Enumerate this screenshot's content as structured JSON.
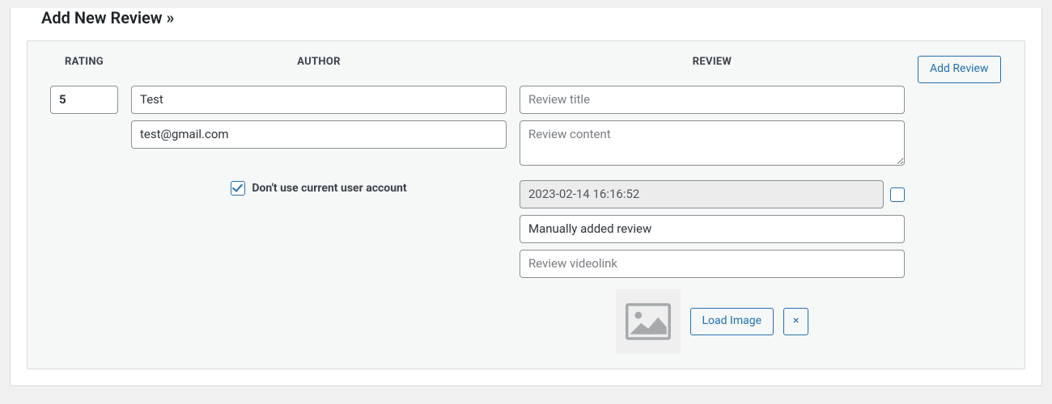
{
  "panel": {
    "title": "Add New Review »"
  },
  "headers": {
    "rating": "RATING",
    "author": "AUTHOR",
    "review": "REVIEW"
  },
  "form": {
    "rating_value": "5",
    "author_name_value": "Test",
    "author_email_value": "test@gmail.com",
    "dont_use_account_label": "Don't use current user account",
    "dont_use_account_checked": true,
    "review_title_placeholder": "Review title",
    "review_title_value": "",
    "review_content_placeholder": "Review content",
    "review_content_value": "",
    "date_value": "2023-02-14 16:16:52",
    "date_checkbox_checked": false,
    "source_value": "Manually added review",
    "videolink_placeholder": "Review videolink",
    "videolink_value": ""
  },
  "buttons": {
    "load_image": "Load Image",
    "clear_image": "×",
    "add_review": "Add Review"
  },
  "icons": {
    "placeholder_image": "placeholder-image-icon"
  }
}
